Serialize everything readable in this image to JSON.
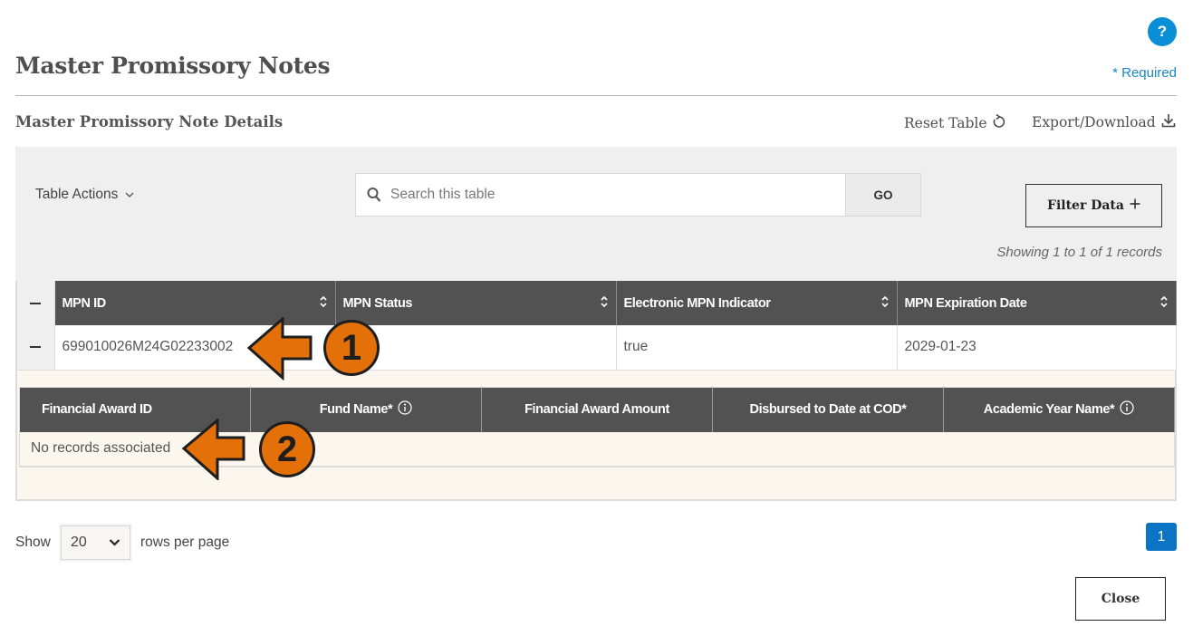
{
  "header": {
    "help_label": "?",
    "title": "Master Promissory Notes",
    "required_note": "* Required"
  },
  "section": {
    "title": "Master Promissory Note Details",
    "reset_label": "Reset Table",
    "export_label": "Export/Download"
  },
  "toolbar": {
    "table_actions_label": "Table Actions",
    "search_placeholder": "Search this table",
    "search_value": "",
    "go_label": "GO",
    "filter_label": "Filter Data",
    "showing_text": "Showing 1 to 1 of 1 records"
  },
  "main_table": {
    "columns": [
      "MPN ID",
      "MPN Status",
      "Electronic MPN Indicator",
      "MPN Expiration Date"
    ],
    "rows": [
      {
        "mpn_id": "699010026M24G02233002",
        "mpn_status": "",
        "electronic_indicator": "true",
        "expiration_date": "2029-01-23"
      }
    ]
  },
  "sub_table": {
    "columns": [
      "Financial Award ID",
      "Fund Name*",
      "Financial Award Amount",
      "Disbursed to Date at COD*",
      "Academic Year Name*"
    ],
    "empty_text": "No records associated"
  },
  "pagination": {
    "show_label": "Show",
    "rows_per_page_value": "20",
    "rows_per_page_label": "rows per page",
    "current_page": "1"
  },
  "footer": {
    "close_label": "Close"
  },
  "annotations": [
    {
      "number": "1",
      "target": "MPN ID value"
    },
    {
      "number": "2",
      "target": "No records associated"
    }
  ],
  "colors": {
    "accent_blue": "#0a8fd6",
    "page_button": "#0b74c4",
    "header_dark": "#525252",
    "callout_orange": "#e37008",
    "sub_row_bg": "#fbf7ee"
  }
}
